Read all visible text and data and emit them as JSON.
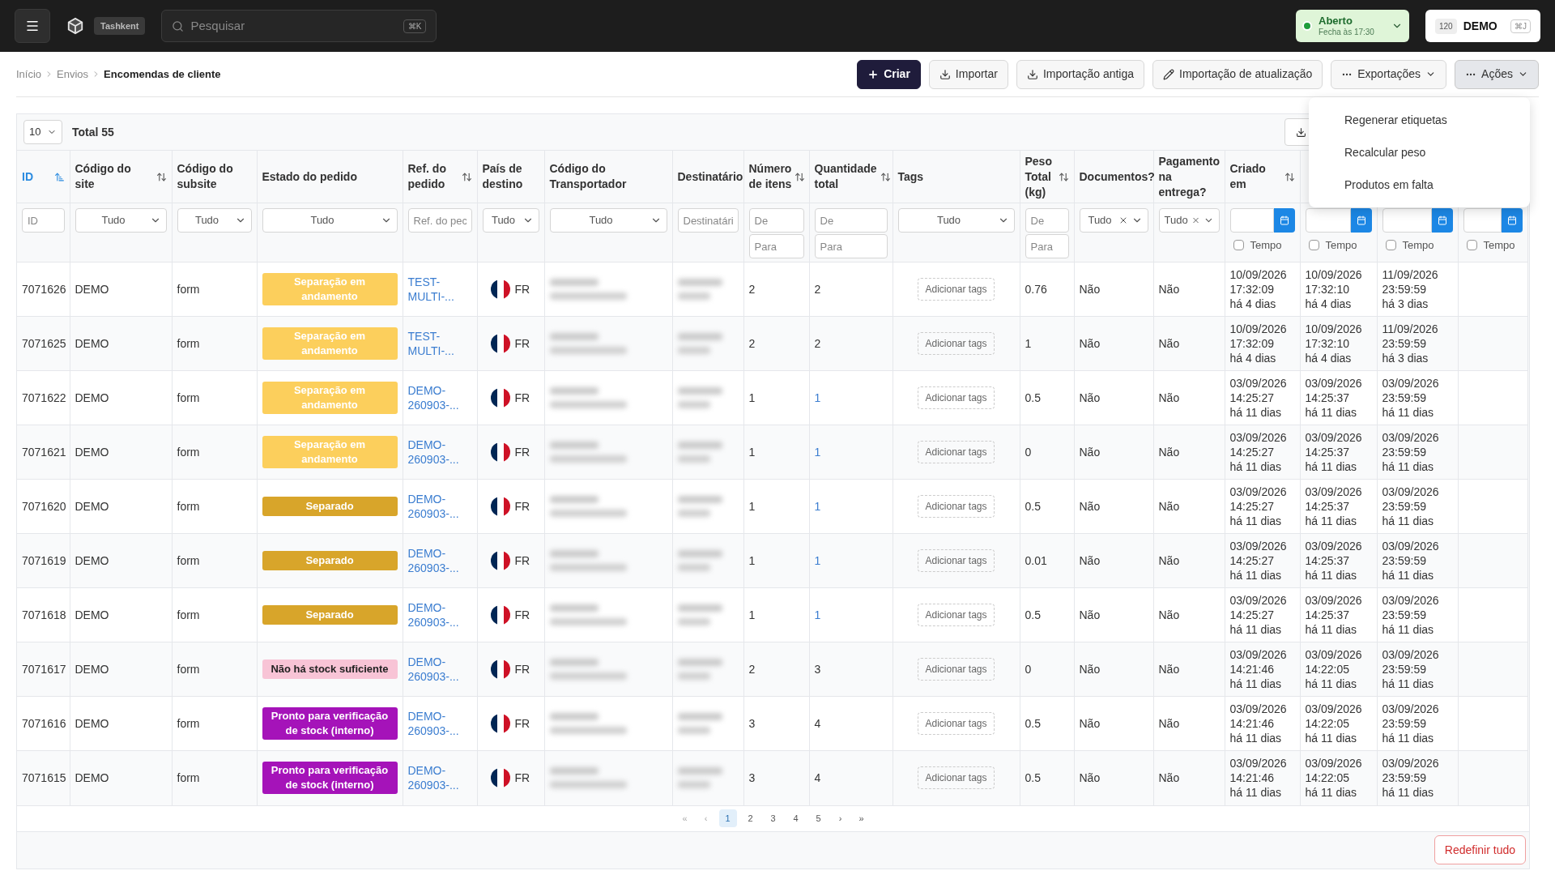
{
  "topbar": {
    "org_badge": "Tashkent",
    "search": {
      "placeholder": "Pesquisar",
      "shortcut": "⌘K"
    },
    "store_status": {
      "open": true,
      "label": "Aberto",
      "sub": "Fecha às 17:30"
    },
    "account": {
      "count": "120",
      "name": "DEMO",
      "shortcut": "⌘J"
    }
  },
  "breadcrumb": [
    "Início",
    "Envios",
    "Encomendas de cliente"
  ],
  "actions": [
    {
      "kind": "primary",
      "label": "Criar",
      "selected": false
    },
    {
      "kind": "outline",
      "label": "Importar",
      "selected": false
    },
    {
      "kind": "outline",
      "label": "Importação antiga",
      "selected": false
    },
    {
      "kind": "outline",
      "label": "Importação de atualização",
      "selected": false
    },
    {
      "kind": "menu",
      "label": "Exportações",
      "selected": false
    },
    {
      "kind": "menu",
      "label": "Ações",
      "selected": true
    }
  ],
  "actions_menu": [
    "Regenerar etiquetas",
    "Recalcular peso",
    "Produtos em falta"
  ],
  "table": {
    "page_size": "10",
    "total": "Total 55",
    "columns": [
      {
        "label": "ID",
        "sort_active": true,
        "filter": {
          "kind": "text",
          "placeholder": "ID"
        }
      },
      {
        "label": "Código do site",
        "sort_active": false,
        "filter": {
          "kind": "select",
          "value": "Tudo",
          "clearable": false
        }
      },
      {
        "label": "Código do subsite",
        "filter": {
          "kind": "select",
          "value": "Tudo",
          "clearable": false
        }
      },
      {
        "label": "Estado do pedido",
        "filter": {
          "kind": "select",
          "value": "Tudo",
          "clearable": false
        }
      },
      {
        "label": "Ref. do pedido",
        "sort_active": false,
        "filter": {
          "kind": "text",
          "placeholder": "Ref. do pec"
        }
      },
      {
        "label": "País de destino",
        "filter": {
          "kind": "select",
          "value": "Tudo",
          "clearable": false
        }
      },
      {
        "label": "Código do Transportador",
        "filter": {
          "kind": "select",
          "value": "Tudo",
          "clearable": false
        }
      },
      {
        "label": "Destinatário",
        "filter": {
          "kind": "text",
          "placeholder": "Destinatári"
        }
      },
      {
        "label": "Número de itens",
        "sort_active": false,
        "filter": {
          "kind": "range",
          "fields": [
            {
              "placeholder": "De"
            },
            {
              "placeholder": "Para"
            }
          ]
        }
      },
      {
        "label": "Quantidade total",
        "sort_active": false,
        "filter": {
          "kind": "range",
          "fields": [
            {
              "placeholder": "De"
            },
            {
              "placeholder": "Para"
            }
          ]
        }
      },
      {
        "label": "Tags",
        "filter": {
          "kind": "select",
          "value": "Tudo",
          "clearable": false
        }
      },
      {
        "label": "Peso Total (kg)",
        "sort_active": false,
        "filter": {
          "kind": "range",
          "fields": [
            {
              "placeholder": "De"
            },
            {
              "placeholder": "Para"
            }
          ]
        }
      },
      {
        "label": "Documentos?",
        "filter": {
          "kind": "select",
          "value": "Tudo",
          "clearable": true
        }
      },
      {
        "label": "Pagamento na entrega?",
        "filter": {
          "kind": "select",
          "value": "Tudo",
          "clearable": true
        }
      },
      {
        "label": "Criado em",
        "sort_active": false,
        "filter": {
          "kind": "date",
          "toggle": "Tempo",
          "checked": false
        }
      },
      {
        "filter": {
          "kind": "date",
          "toggle": "Tempo",
          "checked": false
        }
      },
      {
        "filter": {
          "kind": "date",
          "toggle": "Tempo",
          "checked": false
        }
      },
      {
        "filter": {
          "kind": "date",
          "toggle": "Tempo",
          "checked": false
        }
      }
    ],
    "rows": [
      {
        "id": "7071626",
        "site": "DEMO",
        "subsite": "form",
        "status": {
          "kind": "in_progress",
          "label": "Separação em andamento"
        },
        "ref": "TEST-MULTI-...",
        "country": "FR",
        "items": "2",
        "total": "2",
        "total_linked": false,
        "tags": "Adicionar tags",
        "weight": "0.76",
        "documents": "Não",
        "cod": "Não",
        "dates": [
          [
            "10/09/2026",
            "17:32:09",
            "há 4 dias"
          ],
          [
            "10/09/2026",
            "17:32:10",
            "há 4 dias"
          ],
          [
            "11/09/2026",
            "23:59:59",
            "há 3 dias"
          ]
        ]
      },
      {
        "id": "7071625",
        "site": "DEMO",
        "subsite": "form",
        "status": {
          "kind": "in_progress",
          "label": "Separação em andamento"
        },
        "ref": "TEST-MULTI-...",
        "country": "FR",
        "items": "2",
        "total": "2",
        "total_linked": false,
        "tags": "Adicionar tags",
        "weight": "1",
        "documents": "Não",
        "cod": "Não",
        "dates": [
          [
            "10/09/2026",
            "17:32:09",
            "há 4 dias"
          ],
          [
            "10/09/2026",
            "17:32:10",
            "há 4 dias"
          ],
          [
            "11/09/2026",
            "23:59:59",
            "há 3 dias"
          ]
        ]
      },
      {
        "id": "7071622",
        "site": "DEMO",
        "subsite": "form",
        "status": {
          "kind": "in_progress",
          "label": "Separação em andamento"
        },
        "ref": "DEMO-260903-...",
        "country": "FR",
        "items": "1",
        "total": "1",
        "total_linked": true,
        "tags": "Adicionar tags",
        "weight": "0.5",
        "documents": "Não",
        "cod": "Não",
        "dates": [
          [
            "03/09/2026",
            "14:25:27",
            "há 11 dias"
          ],
          [
            "03/09/2026",
            "14:25:37",
            "há 11 dias"
          ],
          [
            "03/09/2026",
            "23:59:59",
            "há 11 dias"
          ]
        ]
      },
      {
        "id": "7071621",
        "site": "DEMO",
        "subsite": "form",
        "status": {
          "kind": "in_progress",
          "label": "Separação em andamento"
        },
        "ref": "DEMO-260903-...",
        "country": "FR",
        "items": "1",
        "total": "1",
        "total_linked": true,
        "tags": "Adicionar tags",
        "weight": "0",
        "documents": "Não",
        "cod": "Não",
        "dates": [
          [
            "03/09/2026",
            "14:25:27",
            "há 11 dias"
          ],
          [
            "03/09/2026",
            "14:25:37",
            "há 11 dias"
          ],
          [
            "03/09/2026",
            "23:59:59",
            "há 11 dias"
          ]
        ]
      },
      {
        "id": "7071620",
        "site": "DEMO",
        "subsite": "form",
        "status": {
          "kind": "picked",
          "label": "Separado"
        },
        "ref": "DEMO-260903-...",
        "country": "FR",
        "items": "1",
        "total": "1",
        "total_linked": true,
        "tags": "Adicionar tags",
        "weight": "0.5",
        "documents": "Não",
        "cod": "Não",
        "dates": [
          [
            "03/09/2026",
            "14:25:27",
            "há 11 dias"
          ],
          [
            "03/09/2026",
            "14:25:37",
            "há 11 dias"
          ],
          [
            "03/09/2026",
            "23:59:59",
            "há 11 dias"
          ]
        ]
      },
      {
        "id": "7071619",
        "site": "DEMO",
        "subsite": "form",
        "status": {
          "kind": "picked",
          "label": "Separado"
        },
        "ref": "DEMO-260903-...",
        "country": "FR",
        "items": "1",
        "total": "1",
        "total_linked": true,
        "tags": "Adicionar tags",
        "weight": "0.01",
        "documents": "Não",
        "cod": "Não",
        "dates": [
          [
            "03/09/2026",
            "14:25:27",
            "há 11 dias"
          ],
          [
            "03/09/2026",
            "14:25:37",
            "há 11 dias"
          ],
          [
            "03/09/2026",
            "23:59:59",
            "há 11 dias"
          ]
        ]
      },
      {
        "id": "7071618",
        "site": "DEMO",
        "subsite": "form",
        "status": {
          "kind": "picked",
          "label": "Separado"
        },
        "ref": "DEMO-260903-...",
        "country": "FR",
        "items": "1",
        "total": "1",
        "total_linked": true,
        "tags": "Adicionar tags",
        "weight": "0.5",
        "documents": "Não",
        "cod": "Não",
        "dates": [
          [
            "03/09/2026",
            "14:25:27",
            "há 11 dias"
          ],
          [
            "03/09/2026",
            "14:25:37",
            "há 11 dias"
          ],
          [
            "03/09/2026",
            "23:59:59",
            "há 11 dias"
          ]
        ]
      },
      {
        "id": "7071617",
        "site": "DEMO",
        "subsite": "form",
        "status": {
          "kind": "no_stock",
          "label": "Não há stock suficiente"
        },
        "ref": "DEMO-260903-...",
        "country": "FR",
        "items": "2",
        "total": "3",
        "total_linked": false,
        "tags": "Adicionar tags",
        "weight": "0",
        "documents": "Não",
        "cod": "Não",
        "dates": [
          [
            "03/09/2026",
            "14:21:46",
            "há 11 dias"
          ],
          [
            "03/09/2026",
            "14:22:05",
            "há 11 dias"
          ],
          [
            "03/09/2026",
            "23:59:59",
            "há 11 dias"
          ]
        ]
      },
      {
        "id": "7071616",
        "site": "DEMO",
        "subsite": "form",
        "status": {
          "kind": "ready_check",
          "label": "Pronto para verificação de stock (interno)"
        },
        "ref": "DEMO-260903-...",
        "country": "FR",
        "items": "3",
        "total": "4",
        "total_linked": false,
        "tags": "Adicionar tags",
        "weight": "0.5",
        "documents": "Não",
        "cod": "Não",
        "dates": [
          [
            "03/09/2026",
            "14:21:46",
            "há 11 dias"
          ],
          [
            "03/09/2026",
            "14:22:05",
            "há 11 dias"
          ],
          [
            "03/09/2026",
            "23:59:59",
            "há 11 dias"
          ]
        ]
      },
      {
        "id": "7071615",
        "site": "DEMO",
        "subsite": "form",
        "status": {
          "kind": "ready_check",
          "label": "Pronto para verificação de stock (interno)"
        },
        "ref": "DEMO-260903-...",
        "country": "FR",
        "items": "3",
        "total": "4",
        "total_linked": false,
        "tags": "Adicionar tags",
        "weight": "0.5",
        "documents": "Não",
        "cod": "Não",
        "dates": [
          [
            "03/09/2026",
            "14:21:46",
            "há 11 dias"
          ],
          [
            "03/09/2026",
            "14:22:05",
            "há 11 dias"
          ],
          [
            "03/09/2026",
            "23:59:59",
            "há 11 dias"
          ]
        ]
      }
    ]
  },
  "pagination": {
    "first": "«",
    "prev": "‹",
    "pages": [
      {
        "label": "1",
        "selected": true
      },
      {
        "label": "2",
        "selected": false
      },
      {
        "label": "3",
        "selected": false
      },
      {
        "label": "4",
        "selected": false
      },
      {
        "label": "5",
        "selected": false
      }
    ],
    "next": "›",
    "last": "»"
  },
  "footer": {
    "reset": "Redefinir tudo"
  }
}
